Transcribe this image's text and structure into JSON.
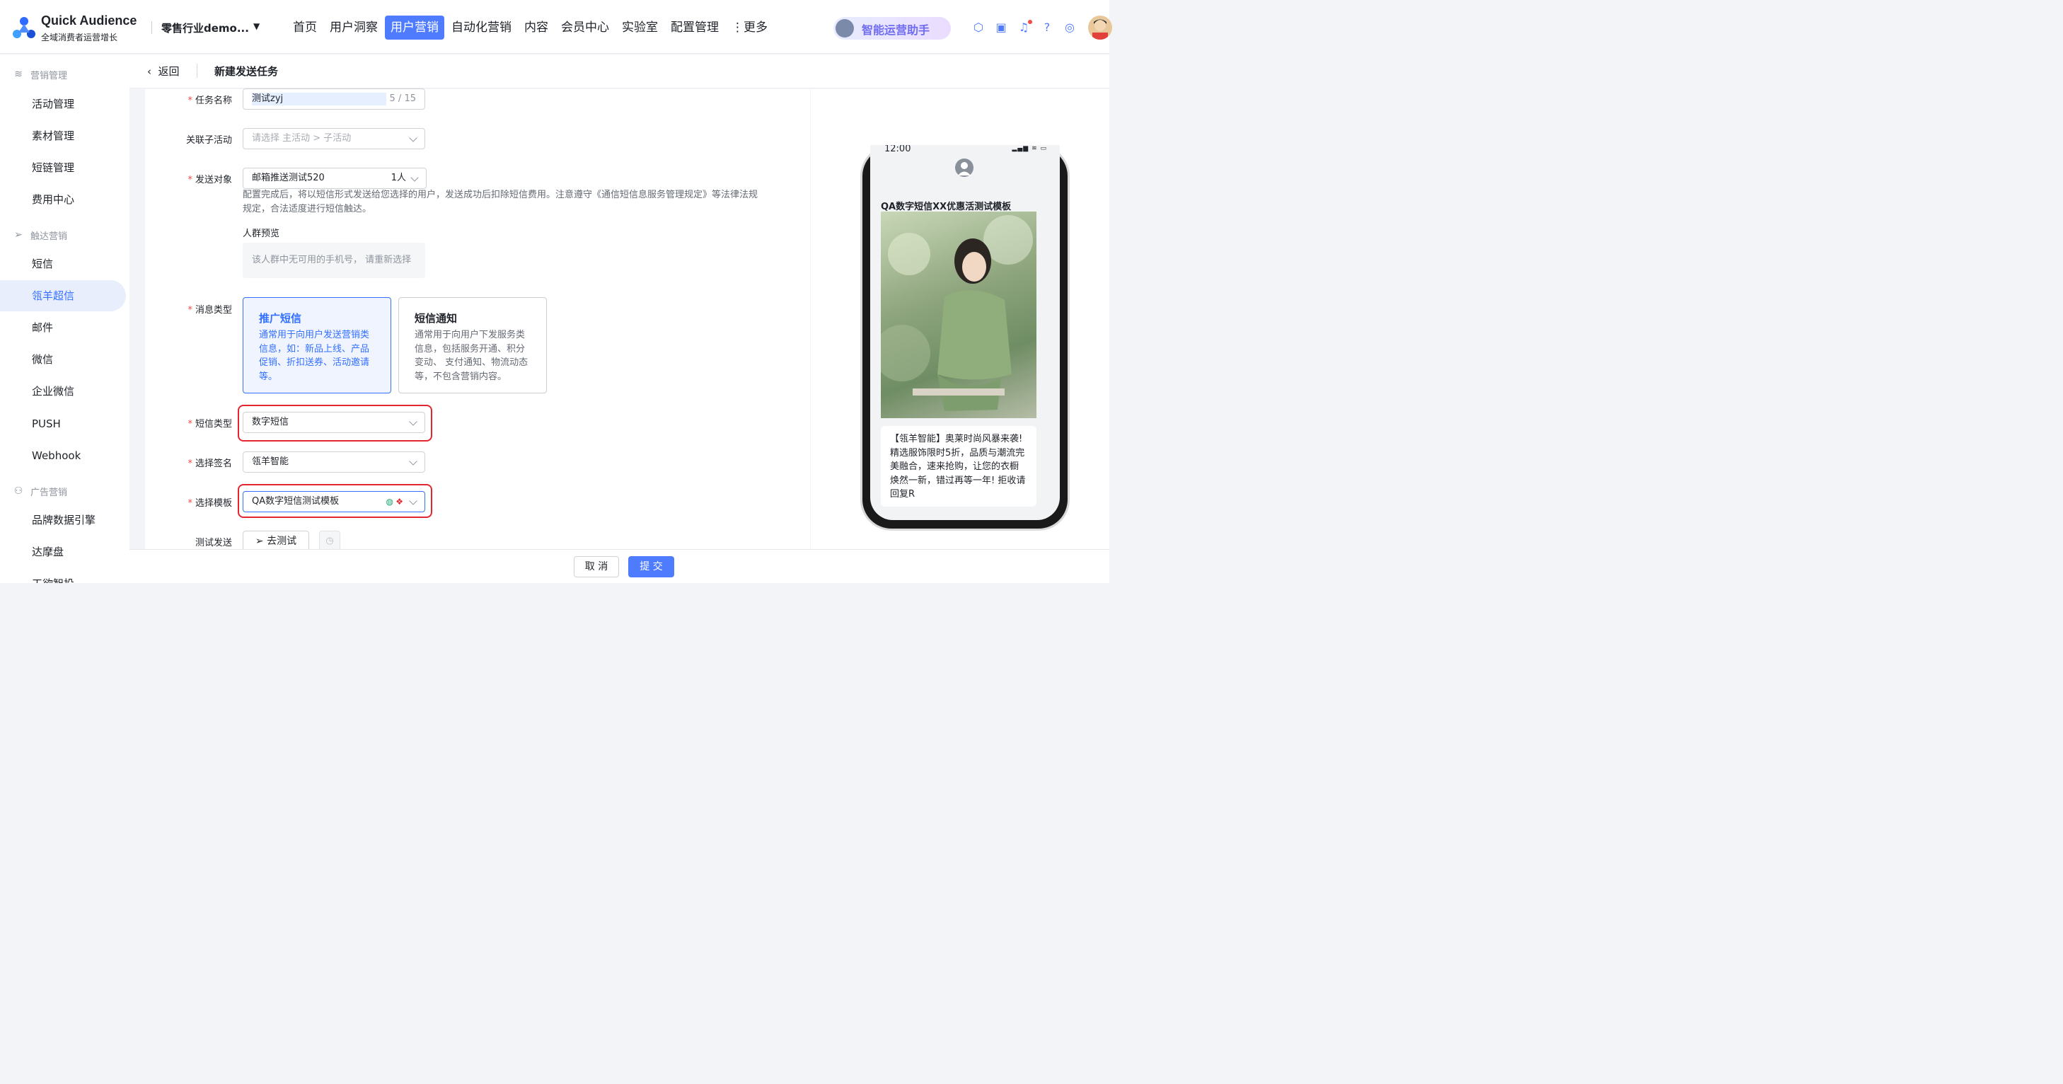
{
  "header": {
    "brand": "Quick Audience",
    "brand_sub": "全域消费者运营增长",
    "tenant": "零售行业demo...",
    "nav": [
      "首页",
      "用户洞察",
      "用户营销",
      "自动化营销",
      "内容",
      "会员中心",
      "实验室",
      "配置管理",
      "更多"
    ],
    "active_nav": "用户营销",
    "assistant": "智能运营助手"
  },
  "sidebar": {
    "groups": [
      {
        "title": "营销管理",
        "icon": "layers-icon",
        "items": [
          "活动管理",
          "素材管理",
          "短链管理",
          "费用中心"
        ]
      },
      {
        "title": "触达营销",
        "icon": "send-icon",
        "items": [
          "短信",
          "瓴羊超信",
          "邮件",
          "微信",
          "企业微信",
          "PUSH",
          "Webhook"
        ]
      },
      {
        "title": "广告营销",
        "icon": "ad-icon",
        "items": [
          "品牌数据引擎",
          "达摩盘",
          "工欲智投"
        ]
      }
    ],
    "active_item": "瓴羊超信"
  },
  "page": {
    "back": "返回",
    "title": "新建发送任务"
  },
  "form": {
    "task_name_label": "任务名称",
    "task_name_value": "测试zyj",
    "task_name_count": "5 / 15",
    "sub_activity_label": "关联子活动",
    "sub_activity_placeholder": "请选择 主活动 > 子活动",
    "target_label": "发送对象",
    "target_value": "邮箱推送测试520",
    "target_count": "1人",
    "target_hint": "配置完成后，将以短信形式发送给您选择的用户，发送成功后扣除短信费用。注意遵守《通信短信息服务管理规定》等法律法规规定，合法适度进行短信触达。",
    "preview_label": "人群预览",
    "preview_empty": "该人群中无可用的手机号， 请重新选择",
    "msg_type_label": "消息类型",
    "msg_types": [
      {
        "title": "推广短信",
        "desc": "通常用于向用户发送营销类信息，如：新品上线、产品促销、折扣送券、活动邀请等。",
        "selected": true
      },
      {
        "title": "短信通知",
        "desc": "通常用于向用户下发服务类信息，包括服务开通、积分变动、 支付通知、物流动态等，不包含营销内容。",
        "selected": false
      }
    ],
    "sms_type_label": "短信类型",
    "sms_type_value": "数字短信",
    "signature_label": "选择签名",
    "signature_value": "瓴羊智能",
    "template_label": "选择模板",
    "template_value": "QA数字短信测试模板",
    "test_label": "测试发送",
    "test_button": "去测试"
  },
  "footer": {
    "cancel": "取 消",
    "submit": "提 交"
  },
  "phone_preview": {
    "time": "12:00",
    "message_title": "QA数字短信XX优惠活测试模板",
    "message_body": "【瓴羊智能】奥莱时尚风暴来袭!精选服饰限时5折，品质与潮流完美融合，速来抢购，让您的衣橱焕然一新，错过再等一年! 拒收请回复R"
  },
  "colors": {
    "primary": "#4f7cff",
    "highlight": "#e3262e",
    "selected_text": "#3370ff"
  }
}
